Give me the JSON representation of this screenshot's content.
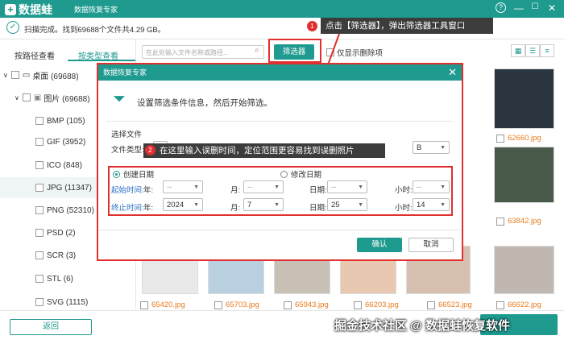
{
  "app": {
    "logo_text": "数据蛙",
    "title": "数据恢复专家",
    "help": "?",
    "min": "—",
    "max": "☐",
    "close": "✕"
  },
  "status": {
    "text": "扫描完成。找到69688个文件共4.29 GB。"
  },
  "tabs": [
    "按路径查看",
    "按类型查看"
  ],
  "tree": [
    {
      "label": "桌面 (69688)",
      "level": 0
    },
    {
      "label": "图片 (69688)",
      "level": 1
    },
    {
      "label": "BMP (105)",
      "level": 2
    },
    {
      "label": "GIF (3952)",
      "level": 2
    },
    {
      "label": "ICO (848)",
      "level": 2
    },
    {
      "label": "JPG (11347)",
      "level": 2,
      "selected": true
    },
    {
      "label": "PNG (52310)",
      "level": 2
    },
    {
      "label": "PSD (2)",
      "level": 2
    },
    {
      "label": "SCR (3)",
      "level": 2
    },
    {
      "label": "STL (6)",
      "level": 2
    },
    {
      "label": "SVG (1115)",
      "level": 2
    }
  ],
  "toolbar": {
    "search_placeholder": "在此处输入文件名称或路径...",
    "filter_label": "筛选器",
    "show_deleted": "仅显示删除项"
  },
  "callout1": {
    "num": "1",
    "text": "点击【筛选器】，弹出筛选器工具窗口"
  },
  "files_right": [
    "62660.jpg",
    "63842.jpg"
  ],
  "files_bottom": [
    "65420.jpg",
    "65703.jpg",
    "65943.jpg",
    "66203.jpg",
    "66523.jpg",
    "66622.jpg"
  ],
  "dialog": {
    "title": "数据恢复专家",
    "header": "设置筛选条件信息，然后开始筛选。",
    "select_file": "选择文件",
    "file_type": "文件类型:",
    "size_unit": "B",
    "create_date": "创建日期",
    "modify_date": "修改日期",
    "start_time": "起始时间:",
    "end_time": "终止时间:",
    "year": "年:",
    "month": "月:",
    "day": "日期:",
    "hour": "小时:",
    "start_vals": {
      "year": "--",
      "month": "--",
      "day": "--",
      "hour": "--"
    },
    "end_vals": {
      "year": "2024",
      "month": "7",
      "day": "25",
      "hour": "14"
    },
    "ok": "确认",
    "cancel": "取消"
  },
  "callout2": {
    "num": "2",
    "text": "在这里输入误删时间，定位范围更容易找到误删照片"
  },
  "back": "返回",
  "watermark": "掘金技术社区 @ 数据蛙恢复软件",
  "colors": {
    "brand": "#1f9a8f",
    "highlight": "#e03030",
    "filename": "#e87a1e"
  }
}
